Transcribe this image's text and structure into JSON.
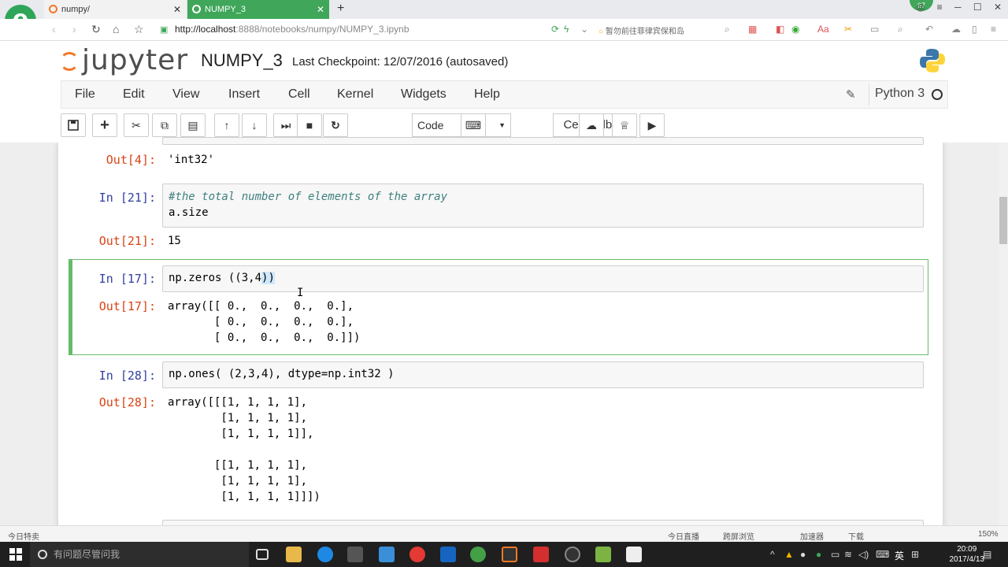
{
  "browser": {
    "tabs": [
      {
        "label": "numpy/"
      },
      {
        "label": "NUMPY_3"
      }
    ],
    "new_tab_icon": "+",
    "badge": "67",
    "url_host": "http://localhost",
    "url_rest": ":8888/notebooks/numpy/NUMPY_3.ipynb",
    "search_hint": "暂勿前往菲律宾保和岛",
    "status_left": "今日特卖",
    "status_items": [
      "今日直播",
      "跨屏浏览",
      "加速器",
      "下载",
      "150%"
    ]
  },
  "jupyter": {
    "logo_text": "jupyter",
    "notebook_name": "NUMPY_3",
    "checkpoint": "Last Checkpoint: 12/07/2016 (autosaved)",
    "menu": [
      "File",
      "Edit",
      "View",
      "Insert",
      "Cell",
      "Kernel",
      "Widgets",
      "Help"
    ],
    "kernel_name": "Python 3",
    "cell_type": "Code",
    "celltoolbar_label": "CellToolbar"
  },
  "cells": {
    "out4_prompt": "Out[4]:",
    "out4_text": "'int32'",
    "in21_prompt": "In [21]:",
    "in21_comment": "#the total number of elements of the array",
    "in21_code": "a.size",
    "out21_prompt": "Out[21]:",
    "out21_text": "15",
    "in17_prompt": "In [17]:",
    "in17_code_a": "np.zeros ((3,4",
    "in17_code_b": "))",
    "out17_prompt": "Out[17]:",
    "out17_text": "array([[ 0.,  0.,  0.,  0.],\n       [ 0.,  0.,  0.,  0.],\n       [ 0.,  0.,  0.,  0.]])",
    "in28_prompt": "In [28]:",
    "in28_code": "np.ones( (2,3,4), dtype=np.int32 )",
    "out28_prompt": "Out[28]:",
    "out28_text": "array([[[1, 1, 1, 1],\n        [1, 1, 1, 1],\n        [1, 1, 1, 1]],\n\n       [[1, 1, 1, 1],\n        [1, 1, 1, 1],\n        [1, 1, 1, 1]]])"
  },
  "taskbar": {
    "search_placeholder": "有问题尽管问我",
    "ime": "英",
    "time": "20:09",
    "date": "2017/4/13"
  },
  "colors": {
    "jupyter_orange": "#f37726",
    "selected_cell_border": "#66bb6a",
    "in_prompt": "#303f9f",
    "out_prompt": "#d84315"
  }
}
